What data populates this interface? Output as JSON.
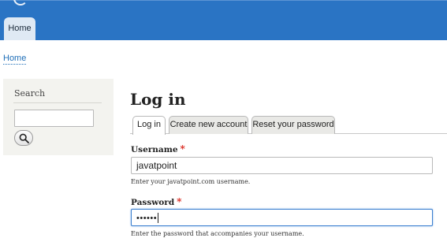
{
  "header": {
    "bar_color": "#2a74c4",
    "home_tab_label": "Home"
  },
  "breadcrumb": {
    "home_label": "Home"
  },
  "sidebar": {
    "search_title": "Search",
    "search_value": "",
    "search_button_icon": "search-icon"
  },
  "main": {
    "title": "Log in",
    "tabs": [
      {
        "label": "Log in",
        "active": true
      },
      {
        "label": "Create new account",
        "active": false
      },
      {
        "label": "Reset your password",
        "active": false
      }
    ],
    "username": {
      "label": "Username",
      "required_marker": "*",
      "value": "javatpoint",
      "help": "Enter your javatpoint.com username."
    },
    "password": {
      "label": "Password",
      "required_marker": "*",
      "masked_value": "••••••",
      "help": "Enter the password that accompanies your username."
    }
  }
}
